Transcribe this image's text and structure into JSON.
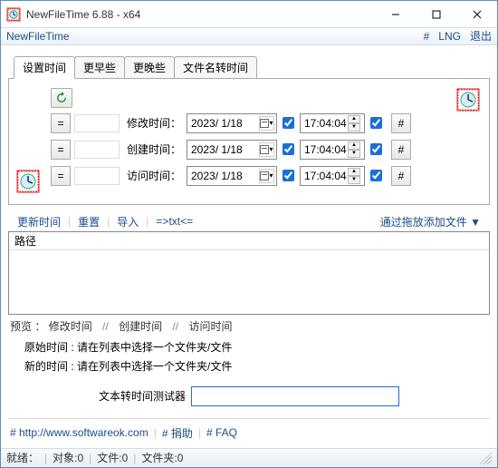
{
  "window": {
    "title": "NewFileTime 6.88 - x64",
    "app_name": "NewFileTime"
  },
  "menubar": {
    "hash": "#",
    "lng": "LNG",
    "exit": "退出"
  },
  "tabs": {
    "t0": "设置时间",
    "t1": "更早些",
    "t2": "更晚些",
    "t3": "文件名转时间"
  },
  "rows": {
    "mod_label": "修改时间：",
    "create_label": "创建时间：",
    "access_label": "访问时间：",
    "date": "2023/ 1/18",
    "time": "17:04:04",
    "eq": "=",
    "hash": "#"
  },
  "toolbar2": {
    "update": "更新时间",
    "reset": "重置",
    "import": "导入",
    "txt": "=>txt<=",
    "dragdrop": "通过拖放添加文件 ▼"
  },
  "list": {
    "hdr_path": "路径"
  },
  "preview": {
    "label": "预览 ：",
    "mod": "修改时间",
    "create": "创建时间",
    "access": "访问时间",
    "orig": "原始时间 :",
    "newt": "新的时间 :",
    "hint": "请在列表中选择一个文件夹/文件"
  },
  "tester": {
    "label": "文本转时间测试器"
  },
  "footer": {
    "url": "# http://www.softwareok.com",
    "donate": "# 捐助",
    "faq": "# FAQ"
  },
  "status": {
    "ready": "就绪：",
    "objs": "对象:0",
    "files": "文件:0",
    "dirs": "文件夹:0"
  }
}
